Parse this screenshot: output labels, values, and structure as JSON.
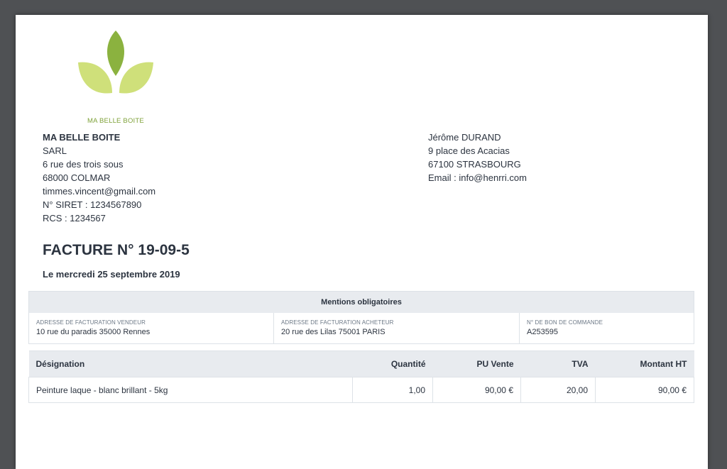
{
  "logo": {
    "company_label": "MA BELLE BOITE",
    "colors": {
      "dark_leaf": "#8bb23f",
      "light_leaf": "#cfe07a"
    }
  },
  "seller": {
    "name": "MA BELLE BOITE",
    "legal_form": "SARL",
    "street": "6 rue des trois sous",
    "city": "68000 COLMAR",
    "email": "timmes.vincent@gmail.com",
    "siret": "N° SIRET : 1234567890",
    "rcs": "RCS : 1234567"
  },
  "buyer": {
    "name": "Jérôme DURAND",
    "street": "9 place des Acacias",
    "city": "67100 STRASBOURG",
    "email": "Email : info@henrri.com"
  },
  "invoice": {
    "title": "FACTURE N° 19-09-5",
    "date": "Le mercredi 25 septembre 2019"
  },
  "mentions": {
    "header": "Mentions obligatoires",
    "cells": [
      {
        "label": "ADRESSE DE FACTURATION VENDEUR",
        "value": "10 rue du paradis 35000 Rennes"
      },
      {
        "label": "ADRESSE DE FACTURATION ACHETEUR",
        "value": "20 rue des Lilas 75001 PARIS"
      },
      {
        "label": "N° DE BON DE COMMANDE",
        "value": "A253595"
      }
    ]
  },
  "items_table": {
    "headers": [
      "Désignation",
      "Quantité",
      "PU Vente",
      "TVA",
      "Montant HT"
    ],
    "rows": [
      [
        "Peinture laque - blanc brillant - 5kg",
        "1,00",
        "90,00 €",
        "20,00",
        "90,00 €"
      ]
    ]
  }
}
